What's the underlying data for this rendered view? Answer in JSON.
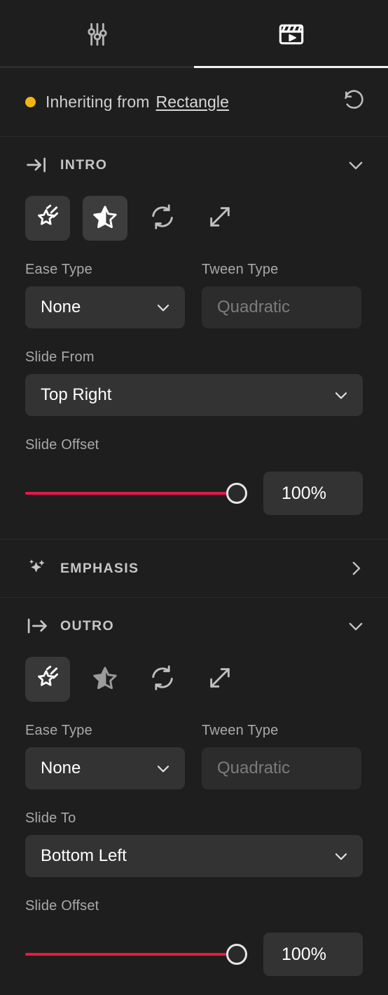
{
  "tabs": [
    {
      "id": "properties",
      "icon": "sliders-icon",
      "active": false
    },
    {
      "id": "animation",
      "icon": "clapperboard-icon",
      "active": true
    }
  ],
  "inherit": {
    "status_dot_color": "#f2b50e",
    "prefix": "Inheriting from",
    "source": "Rectangle",
    "reset_icon": "reset-icon"
  },
  "accent_color": "#f01446",
  "sections": [
    {
      "id": "intro",
      "title": "INTRO",
      "icon": "arrow-to-line-right-icon",
      "expanded": true,
      "chevron": "chevron-down-icon",
      "effects": [
        {
          "name": "shooting-star",
          "selected": true,
          "style": "dark"
        },
        {
          "name": "half-star",
          "selected": true,
          "style": "light"
        },
        {
          "name": "loop",
          "selected": false,
          "style": "none"
        },
        {
          "name": "expand",
          "selected": false,
          "style": "none"
        }
      ],
      "ease_type": {
        "label": "Ease Type",
        "value": "None",
        "disabled": false
      },
      "tween_type": {
        "label": "Tween Type",
        "value": "Quadratic",
        "disabled": true
      },
      "direction": {
        "label": "Slide From",
        "value": "Top Right"
      },
      "offset": {
        "label": "Slide Offset",
        "value": "100%",
        "percent": 100
      }
    },
    {
      "id": "emphasis",
      "title": "EMPHASIS",
      "icon": "sparkles-icon",
      "expanded": false,
      "chevron": "chevron-right-icon"
    },
    {
      "id": "outro",
      "title": "OUTRO",
      "icon": "arrow-from-line-right-icon",
      "expanded": true,
      "chevron": "chevron-down-icon",
      "effects": [
        {
          "name": "shooting-star",
          "selected": true,
          "style": "dark"
        },
        {
          "name": "half-star",
          "selected": false,
          "style": "none"
        },
        {
          "name": "loop",
          "selected": false,
          "style": "none"
        },
        {
          "name": "expand",
          "selected": false,
          "style": "none"
        }
      ],
      "ease_type": {
        "label": "Ease Type",
        "value": "None",
        "disabled": false
      },
      "tween_type": {
        "label": "Tween Type",
        "value": "Quadratic",
        "disabled": true
      },
      "direction": {
        "label": "Slide To",
        "value": "Bottom Left"
      },
      "offset": {
        "label": "Slide Offset",
        "value": "100%",
        "percent": 100
      }
    }
  ]
}
